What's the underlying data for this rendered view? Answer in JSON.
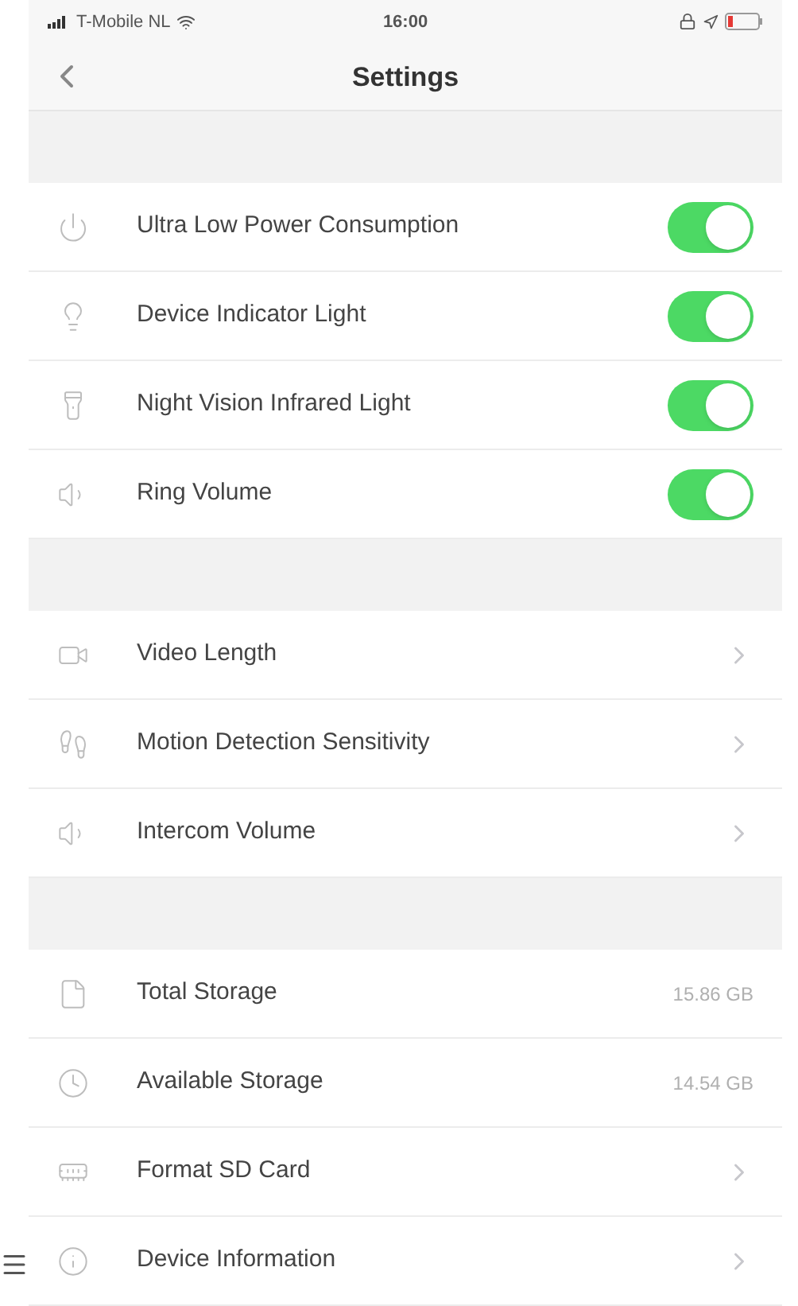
{
  "status_bar": {
    "carrier": "T-Mobile NL",
    "time": "16:00"
  },
  "nav": {
    "title": "Settings"
  },
  "sections": [
    {
      "rows": [
        {
          "kind": "toggle",
          "label": "Ultra Low Power Consumption",
          "on": true
        },
        {
          "kind": "toggle",
          "label": "Device Indicator Light",
          "on": true
        },
        {
          "kind": "toggle",
          "label": "Night Vision Infrared Light",
          "on": true
        },
        {
          "kind": "toggle",
          "label": "Ring Volume",
          "on": true
        }
      ]
    },
    {
      "rows": [
        {
          "kind": "link",
          "label": "Video Length"
        },
        {
          "kind": "link",
          "label": "Motion Detection Sensitivity"
        },
        {
          "kind": "link",
          "label": "Intercom Volume"
        }
      ]
    },
    {
      "rows": [
        {
          "kind": "value",
          "label": "Total Storage",
          "value": "15.86 GB"
        },
        {
          "kind": "value",
          "label": "Available Storage",
          "value": "14.54 GB"
        },
        {
          "kind": "link",
          "label": "Format SD Card"
        },
        {
          "kind": "link",
          "label": "Device Information"
        }
      ]
    }
  ]
}
